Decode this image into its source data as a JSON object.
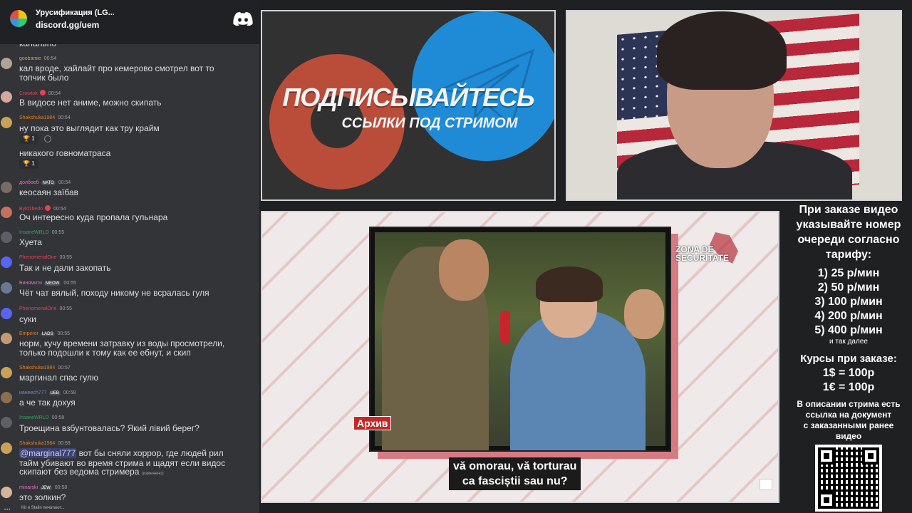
{
  "server": {
    "name": "Урусификация (LG...",
    "invite": "discord.gg/uem"
  },
  "chat": {
    "messages": [
      {
        "user": "",
        "time": "",
        "color": "#9ea0a5",
        "lines": [
          "канально"
        ]
      },
      {
        "user": "goobamie",
        "time": "00:54",
        "color": "#c0a074",
        "lines": [
          "кал вроде, хайлайт про кемерово смотрел вот то",
          "топчик было"
        ]
      },
      {
        "user": "Crowtok",
        "time": "00:54",
        "color": "#e8424f",
        "lines": [
          "В видосе нет аниме, можно скипать"
        ]
      },
      {
        "user": "Shakshuka1984",
        "time": "00:54",
        "color": "#e67e22",
        "lines": [
          "ну пока это выглядит как тру крайм"
        ],
        "reaction": "1"
      },
      {
        "user": "",
        "time": "",
        "color": "#e67e22",
        "lines": [
          "никакого говноматраса"
        ],
        "reaction": "1"
      },
      {
        "user": "долбоеб",
        "badge": "NATO",
        "time": "00:54",
        "color": "#e86fbe",
        "lines": [
          "кеосаян заїбав"
        ]
      },
      {
        "user": "Byld1bedo",
        "time": "00:54",
        "color": "#e8424f",
        "lines": [
          "Оч интересно куда пропала гульнара"
        ]
      },
      {
        "user": "InsaneWRLD",
        "time": "00:55",
        "color": "#3ba55c",
        "lines": [
          "Хуета"
        ]
      },
      {
        "user": "PhenomenalOne",
        "time": "00:55",
        "color": "#e8424f",
        "lines": [
          "Так и не дали закопать"
        ]
      },
      {
        "user": "Бинямити",
        "badge": "MEOW",
        "time": "00:55",
        "color": "#e86fbe",
        "lines": [
          "Чёт чат вялый, походу никому не всралась гуля"
        ]
      },
      {
        "user": "PhenomenalOne",
        "time": "00:55",
        "color": "#e8424f",
        "lines": [
          "суки"
        ]
      },
      {
        "user": "Emperor",
        "badge": "LADS",
        "time": "00:55",
        "color": "#e67e22",
        "lines": [
          "норм, кучу времени затравку из воды просмотрели,",
          "только подошли к тому как ее ебнут, и скип"
        ]
      },
      {
        "user": "Shakshuka1984",
        "time": "00:57",
        "color": "#e67e22",
        "lines": [
          "маргинал спас гулю"
        ]
      },
      {
        "user": "ианеесh777",
        "badge": "UEB",
        "time": "00:58",
        "color": "#7289da",
        "lines": [
          "а че так дохуя"
        ]
      },
      {
        "user": "InsaneWRLD",
        "time": "00:58",
        "color": "#3ba55c",
        "lines": [
          "Троещина взбунтовалась? Який лівий берег?"
        ]
      },
      {
        "user": "Shakshuka1984",
        "time": "00:58",
        "color": "#e67e22",
        "mention": "@marginal777",
        "lines": [
          " вот бы сняли хоррор, где людей рил",
          "тайм убивают во время стрима и щадят если видос",
          "скипают без ведома стримера"
        ],
        "edited": "(изменено)"
      },
      {
        "user": "minarski",
        "badge": "JEW",
        "time": "00:58",
        "color": "#e86fbe",
        "lines": [
          "это золкин?"
        ]
      }
    ],
    "typing": "Kit и Stalin печатают..."
  },
  "promo": {
    "title": "ПОДПИСЫВАЙТЕСЬ",
    "subtitle": "ССЫЛКИ ПОД СТРИМОМ"
  },
  "video": {
    "tag": "Архив",
    "logo_line1": "ZONA DE",
    "logo_line2": "SECURITATE",
    "subtitle_line1": "vă omorau, vă torturau",
    "subtitle_line2": "ca fasciștii sau nu?"
  },
  "info": {
    "heading": [
      "При заказе видео",
      "указывайте номер",
      "очереди согласно",
      "тарифу:"
    ],
    "tariffs": [
      "1) 25 р/мин",
      "2) 50 р/мин",
      "3) 100 р/мин",
      "4) 200 р/мин",
      "5) 400 р/мин"
    ],
    "etc": "и так далее",
    "courses_title": "Курсы при заказе:",
    "courses": [
      "1$ = 100р",
      "1€ = 100р"
    ],
    "note": [
      "В описании стрима есть",
      "ссылка на документ",
      "с заказанными ранее",
      "видео"
    ]
  }
}
